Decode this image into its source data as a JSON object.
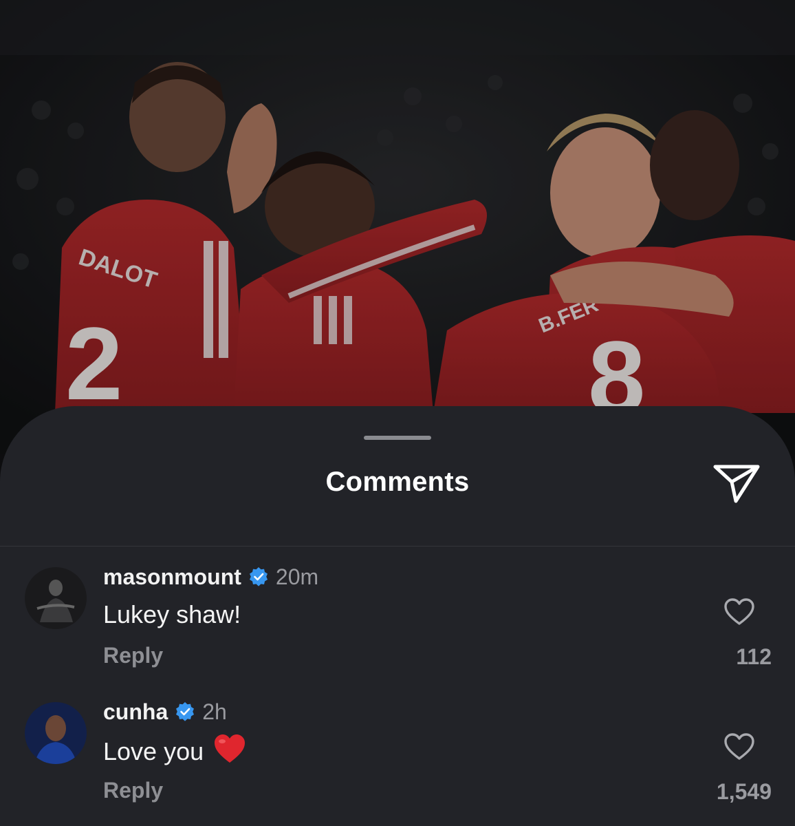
{
  "photo": {
    "description_icon": "celebration-photo",
    "jersey_name_left": "DALOT",
    "jersey_number_left": "2",
    "jersey_name_right": "B.FER",
    "jersey_number_right": "8",
    "kit_color": "#b8262a"
  },
  "sheet": {
    "title": "Comments",
    "share_icon": "send-icon",
    "background": "#222328"
  },
  "comments": [
    {
      "username": "masonmount",
      "verified": true,
      "time": "20m",
      "text": "Lukey shaw!",
      "reply_label": "Reply",
      "likes": "112",
      "avatar_icon": "avatar-masonmount"
    },
    {
      "username": "cunha",
      "verified": true,
      "time": "2h",
      "text": "Love you",
      "emoji_icon": "red-heart-emoji",
      "reply_label": "Reply",
      "likes": "1,549",
      "avatar_icon": "avatar-cunha"
    }
  ],
  "colors": {
    "verified_badge": "#3897f0",
    "emoji_heart": "#e0262e",
    "secondary_text": "#9a9ba0"
  }
}
